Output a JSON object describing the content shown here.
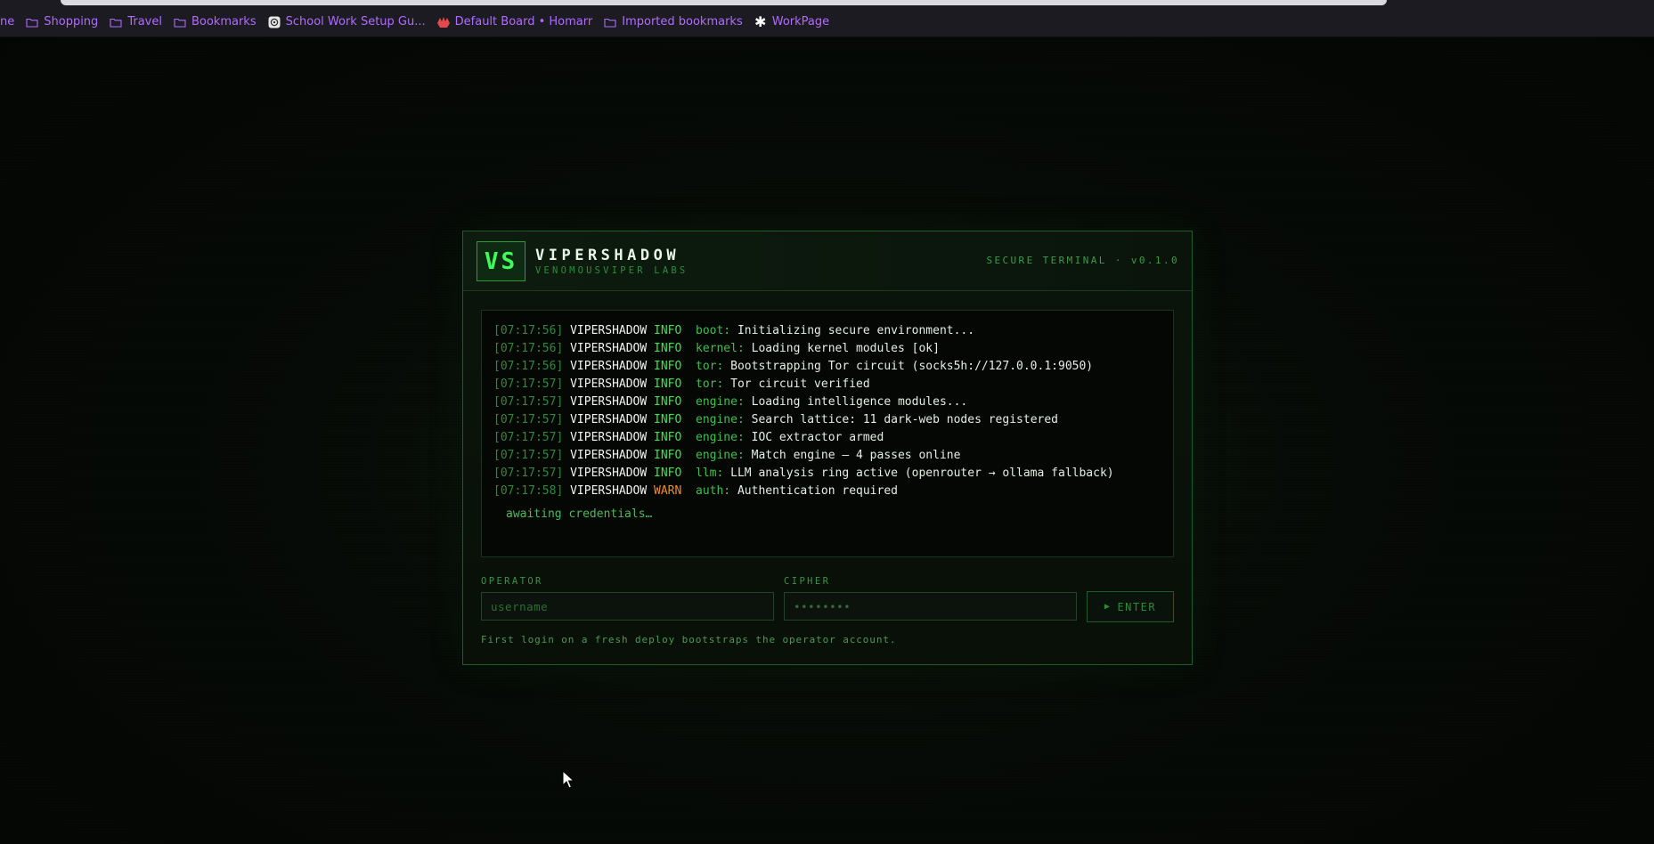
{
  "bookmarks": [
    {
      "label": "ne",
      "icon": "none"
    },
    {
      "label": "Shopping",
      "icon": "folder-icon"
    },
    {
      "label": "Travel",
      "icon": "folder-icon"
    },
    {
      "label": "Bookmarks",
      "icon": "folder-icon"
    },
    {
      "label": "School Work Setup Gu...",
      "icon": "openai-icon"
    },
    {
      "label": "Default Board • Homarr",
      "icon": "homarr-icon"
    },
    {
      "label": "Imported bookmarks",
      "icon": "folder-icon"
    },
    {
      "label": "WorkPage",
      "icon": "asterisk-icon"
    }
  ],
  "card": {
    "logo": "VS",
    "brand": "VIPERSHADOW",
    "sub": "VENOMOUSVIPER LABS",
    "tag": "SECURE TERMINAL · v0.1.0"
  },
  "log": [
    {
      "ts": "[07:17:56]",
      "src": "VIPERSHADOW",
      "level": "INFO",
      "comp": "boot:",
      "msg": "Initializing secure environment..."
    },
    {
      "ts": "[07:17:56]",
      "src": "VIPERSHADOW",
      "level": "INFO",
      "comp": "kernel:",
      "msg": "Loading kernel modules [ok]"
    },
    {
      "ts": "[07:17:56]",
      "src": "VIPERSHADOW",
      "level": "INFO",
      "comp": "tor:",
      "msg": "Bootstrapping Tor circuit (socks5h://127.0.0.1:9050)"
    },
    {
      "ts": "[07:17:57]",
      "src": "VIPERSHADOW",
      "level": "INFO",
      "comp": "tor:",
      "msg": "Tor circuit verified"
    },
    {
      "ts": "[07:17:57]",
      "src": "VIPERSHADOW",
      "level": "INFO",
      "comp": "engine:",
      "msg": "Loading intelligence modules..."
    },
    {
      "ts": "[07:17:57]",
      "src": "VIPERSHADOW",
      "level": "INFO",
      "comp": "engine:",
      "msg": "Search lattice: 11 dark-web nodes registered"
    },
    {
      "ts": "[07:17:57]",
      "src": "VIPERSHADOW",
      "level": "INFO",
      "comp": "engine:",
      "msg": "IOC extractor armed"
    },
    {
      "ts": "[07:17:57]",
      "src": "VIPERSHADOW",
      "level": "INFO",
      "comp": "engine:",
      "msg": "Match engine — 4 passes online"
    },
    {
      "ts": "[07:17:57]",
      "src": "VIPERSHADOW",
      "level": "INFO",
      "comp": "llm:",
      "msg": "LLM analysis ring active (openrouter → ollama fallback)"
    },
    {
      "ts": "[07:17:58]",
      "src": "VIPERSHADOW",
      "level": "WARN",
      "comp": "auth:",
      "msg": "Authentication required"
    }
  ],
  "awaiting": "awaiting credentials…",
  "form": {
    "operator_label": "OPERATOR",
    "operator_placeholder": "username",
    "cipher_label": "CIPHER",
    "cipher_placeholder": "••••••••",
    "enter_icon": "▶",
    "enter_label": "ENTER",
    "hint": "First login on a fresh deploy bootstraps the operator account."
  },
  "colors": {
    "accent": "#3cff5a",
    "info": "#37e64a",
    "warn": "#f08a24",
    "bookmark": "#b06bff"
  }
}
